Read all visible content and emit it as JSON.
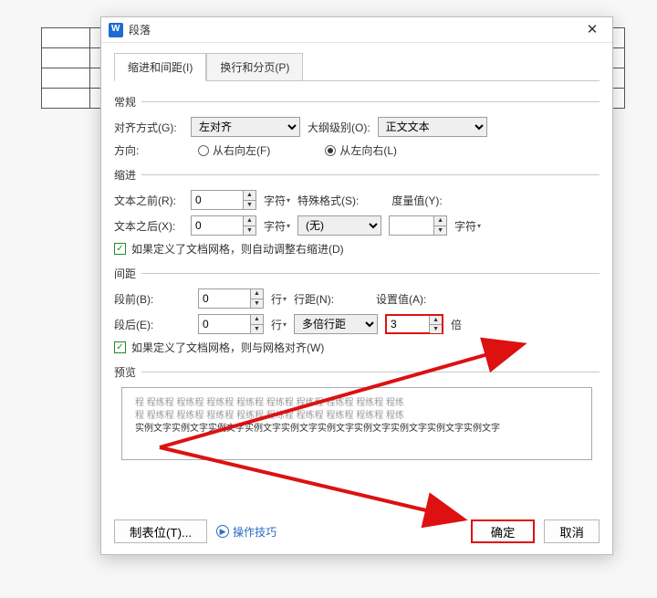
{
  "window": {
    "title": "段落"
  },
  "tabs": {
    "t1": "缩进和间距(I)",
    "t2": "换行和分页(P)"
  },
  "general": {
    "header": "常规",
    "align_label": "对齐方式(G):",
    "align_value": "左对齐",
    "outline_label": "大纲级别(O):",
    "outline_value": "正文文本",
    "direction_label": "方向:",
    "rtl_label": "从右向左(F)",
    "ltr_label": "从左向右(L)"
  },
  "indent": {
    "header": "缩进",
    "before_label": "文本之前(R):",
    "before_value": "0",
    "before_unit": "字符",
    "after_label": "文本之后(X):",
    "after_value": "0",
    "after_unit": "字符",
    "special_label": "特殊格式(S):",
    "special_value": "(无)",
    "measure_label": "度量值(Y):",
    "measure_unit": "字符",
    "auto_label": "如果定义了文档网格，则自动调整右缩进(D)"
  },
  "spacing": {
    "header": "间距",
    "before_label": "段前(B):",
    "before_value": "0",
    "before_unit": "行",
    "after_label": "段后(E):",
    "after_value": "0",
    "after_unit": "行",
    "line_label": "行距(N):",
    "line_value": "多倍行距",
    "set_label": "设置值(A):",
    "set_value": "3",
    "set_unit": "倍",
    "grid_label": "如果定义了文档网格，则与网格对齐(W)"
  },
  "preview": {
    "header": "预览",
    "sample_a": "程   程练程   程练程   程练程   程练程   程练程   程练程   程练程   程练程   程练",
    "sample_b": "程   程练程   程练程   程练程   程练程   程练程   程练程   程练程   程练程   程练",
    "sample_c": "实例文字实例文字实例文字实例文字实例文字实例文字实例文字实例文字实例文字实例文字"
  },
  "footer": {
    "tabs_btn": "制表位(T)...",
    "tips": "操作技巧",
    "ok": "确定",
    "cancel": "取消"
  }
}
